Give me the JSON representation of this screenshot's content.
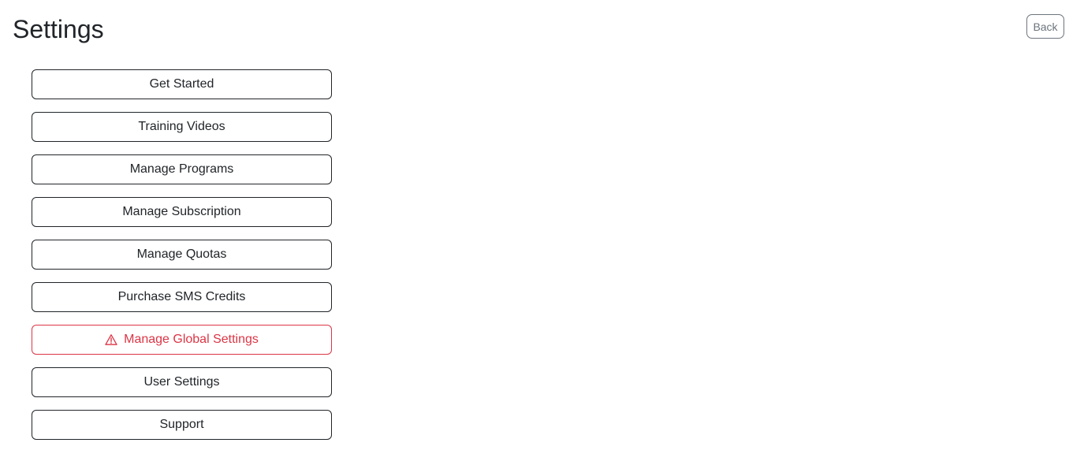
{
  "header": {
    "title": "Settings",
    "back_label": "Back"
  },
  "colors": {
    "danger": "#dc3545",
    "text": "#212529",
    "secondary": "#6c757d"
  },
  "menu": {
    "items": [
      {
        "label": "Get Started"
      },
      {
        "label": "Training Videos"
      },
      {
        "label": "Manage Programs"
      },
      {
        "label": "Manage Subscription"
      },
      {
        "label": "Manage Quotas"
      },
      {
        "label": "Purchase SMS Credits"
      },
      {
        "label": "Manage Global Settings",
        "icon": "warning-triangle-icon",
        "style": "danger"
      },
      {
        "label": "User Settings"
      },
      {
        "label": "Support"
      }
    ]
  }
}
